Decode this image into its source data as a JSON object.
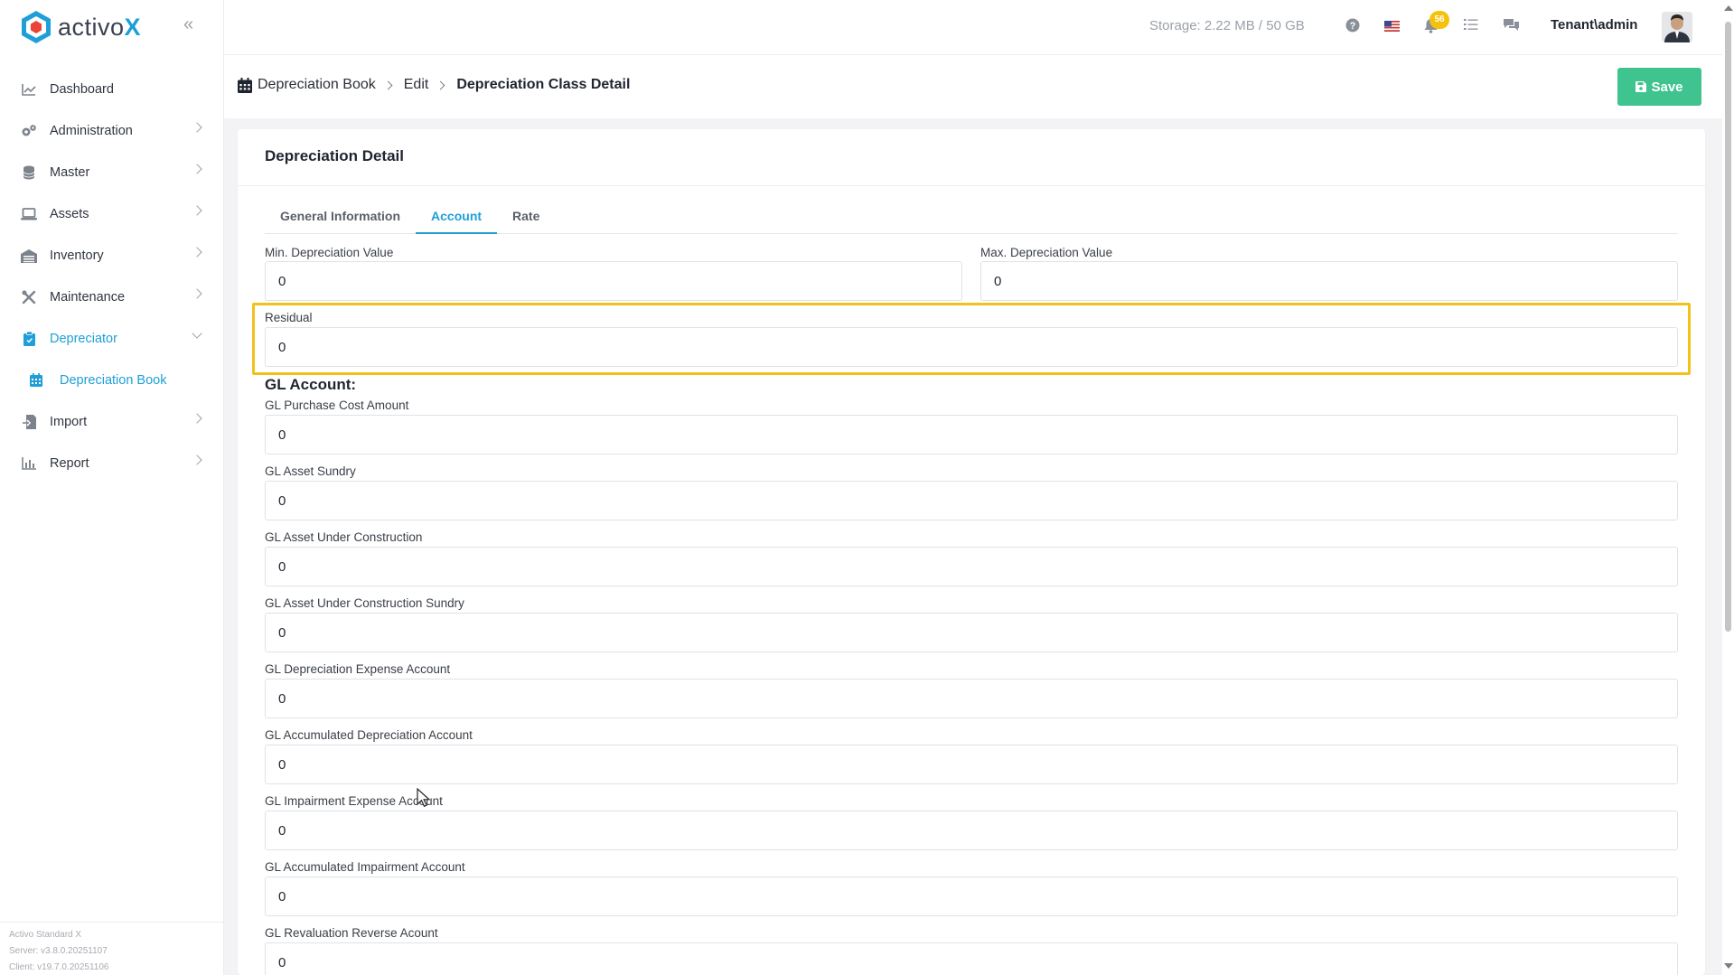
{
  "brand": {
    "name_prefix": "activo",
    "name_suffix": "X"
  },
  "sidebar": {
    "items": [
      {
        "label": "Dashboard",
        "icon": "chart-line-icon"
      },
      {
        "label": "Administration",
        "icon": "gears-icon"
      },
      {
        "label": "Master",
        "icon": "database-icon"
      },
      {
        "label": "Assets",
        "icon": "laptop-icon"
      },
      {
        "label": "Inventory",
        "icon": "warehouse-icon"
      },
      {
        "label": "Maintenance",
        "icon": "tools-icon"
      },
      {
        "label": "Depreciator",
        "icon": "clipboard-icon"
      },
      {
        "label": "Depreciation Book",
        "icon": "calendar-icon"
      },
      {
        "label": "Import",
        "icon": "import-icon"
      },
      {
        "label": "Report",
        "icon": "bar-chart-icon"
      }
    ],
    "footer": {
      "product": "Activo Standard X",
      "server": "Server: v3.8.0.20251107",
      "client": "Client: v19.7.0.20251106"
    }
  },
  "topbar": {
    "storage": "Storage: 2.22 MB / 50 GB",
    "notification_count": "56",
    "user": "Tenant\\admin"
  },
  "breadcrumb": {
    "book": "Depreciation Book",
    "edit": "Edit",
    "current": "Depreciation Class Detail"
  },
  "actions": {
    "save": "Save"
  },
  "card": {
    "title": "Depreciation Detail",
    "tabs": [
      "General Information",
      "Account",
      "Rate"
    ],
    "active_tab": "Account"
  },
  "form": {
    "min_depreciation": {
      "label": "Min. Depreciation Value",
      "value": "0"
    },
    "max_depreciation": {
      "label": "Max. Depreciation Value",
      "value": "0"
    },
    "residual": {
      "label": "Residual",
      "value": "0"
    },
    "gl_section_title": "GL Account:",
    "gl_fields": [
      {
        "label": "GL Purchase Cost Amount",
        "value": "0"
      },
      {
        "label": "GL Asset Sundry",
        "value": "0"
      },
      {
        "label": "GL Asset Under Construction",
        "value": "0"
      },
      {
        "label": "GL Asset Under Construction Sundry",
        "value": "0"
      },
      {
        "label": "GL Depreciation Expense Account",
        "value": "0"
      },
      {
        "label": "GL Accumulated Depreciation Account",
        "value": "0"
      },
      {
        "label": "GL Impairment Expense Account",
        "value": "0"
      },
      {
        "label": "GL Accumulated Impairment Account",
        "value": "0"
      },
      {
        "label": "GL Revaluation Reverse Acount",
        "value": "0"
      }
    ]
  },
  "colors": {
    "accent": "#1e9fd8",
    "save": "#3fc38f",
    "highlight": "#f2c21b",
    "badge": "#f4c20d"
  }
}
